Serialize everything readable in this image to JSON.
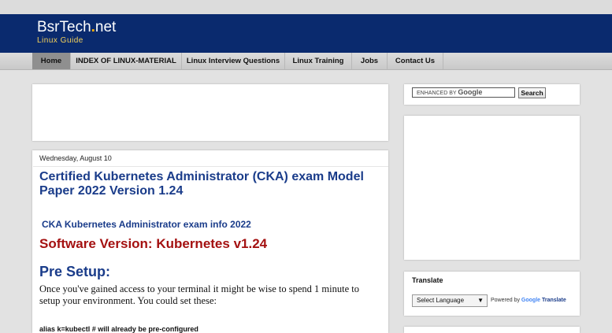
{
  "header": {
    "logo_main": "BsrTech",
    "logo_dot": ".",
    "logo_tld": "net",
    "tagline": "Linux Guide"
  },
  "nav": {
    "items": [
      {
        "label": "Home"
      },
      {
        "label": "INDEX OF LINUX-MATERIAL"
      },
      {
        "label": "Linux Interview Questions"
      },
      {
        "label": "Linux Training"
      },
      {
        "label": "Jobs"
      },
      {
        "label": "Contact Us"
      }
    ]
  },
  "post": {
    "date": "Wednesday, August 10",
    "title": "Certified Kubernetes Administrator (CKA) exam Model Paper 2022 Version 1.24",
    "info_link": "CKA Kubernetes Administrator exam info 2022",
    "software_version": "Software Version: Kubernetes v1.24",
    "pre_setup": "Pre Setup:",
    "paragraph": "Once you've gained access to your terminal it might be wise to spend 1 minute to setup your environment. You could set these:",
    "alias_line": "alias k=kubectl  # will already be pre-configured"
  },
  "sidebar": {
    "search_enhanced": "ENHANCED BY",
    "search_google": "Google",
    "search_button": "Search",
    "translate_title": "Translate",
    "language_select": "Select Language",
    "powered_by": "Powered by",
    "powered_google": "Google",
    "powered_translate": "Translate"
  },
  "colors": {
    "header_bg": "#0a2a6e",
    "title_blue": "#1a3c8a",
    "accent_red": "#a41111",
    "tagline_yellow": "#f5d25a"
  }
}
